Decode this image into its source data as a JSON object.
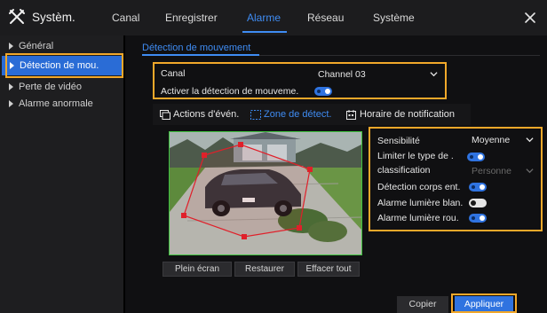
{
  "app": {
    "title": "Systèm."
  },
  "tabs": [
    {
      "label": "Canal"
    },
    {
      "label": "Enregistrer"
    },
    {
      "label": "Alarme",
      "active": true
    },
    {
      "label": "Réseau"
    },
    {
      "label": "Système"
    }
  ],
  "sidebar": {
    "items": [
      {
        "label": "Général"
      },
      {
        "label": "Détection de mou.",
        "active": true
      },
      {
        "label": "Perte de vidéo"
      },
      {
        "label": "Alarme anormale"
      }
    ]
  },
  "section": {
    "title": "Détection de mouvement"
  },
  "channel": {
    "label": "Canal",
    "value": "Channel 03"
  },
  "enable": {
    "label": "Activer la détection de mouveme.",
    "on": true
  },
  "subtabs": [
    {
      "label": "Actions d'évén.",
      "icon": "actions-icon"
    },
    {
      "label": "Zone de détect.",
      "icon": "zone-icon",
      "active": true
    },
    {
      "label": "Horaire de notification",
      "icon": "calendar-icon"
    }
  ],
  "video_buttons": {
    "fullscreen": "Plein écran",
    "restore": "Restaurer",
    "clear": "Effacer tout"
  },
  "settings": {
    "sensitivity": {
      "label": "Sensibilité",
      "value": "Moyenne"
    },
    "limit_type": {
      "label": "Limiter le type de .",
      "on": true
    },
    "classification": {
      "label": "classification",
      "value": "Personne",
      "disabled": true
    },
    "body_detection": {
      "label": "Détection corps ent.",
      "on": true
    },
    "white_light": {
      "label": "Alarme lumière blan.",
      "on": false
    },
    "red_light": {
      "label": "Alarme lumière rou.",
      "on": true
    }
  },
  "actions": {
    "copy": "Copier",
    "apply": "Appliquer"
  },
  "colors": {
    "accent": "#3f8cf3",
    "highlight": "#f2a82a",
    "zone": "#e0202a",
    "video_border": "#3fc23f"
  }
}
